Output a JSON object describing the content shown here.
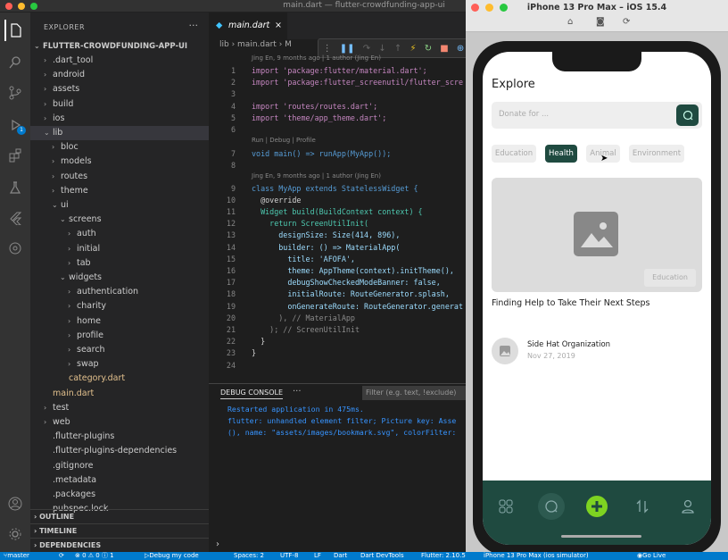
{
  "window": {
    "title": "main.dart — flutter-crowdfunding-app-ui"
  },
  "sidebar": {
    "header": "EXPLORER",
    "root": "FLUTTER-CROWDFUNDING-APP-UI",
    "tree": [
      {
        "label": ".dart_tool",
        "indent": 1,
        "chev": "›"
      },
      {
        "label": "android",
        "indent": 1,
        "chev": "›"
      },
      {
        "label": "assets",
        "indent": 1,
        "chev": "›"
      },
      {
        "label": "build",
        "indent": 1,
        "chev": "›"
      },
      {
        "label": "ios",
        "indent": 1,
        "chev": "›"
      },
      {
        "label": "lib",
        "indent": 1,
        "chev": "⌄"
      },
      {
        "label": "bloc",
        "indent": 2,
        "chev": "›"
      },
      {
        "label": "models",
        "indent": 2,
        "chev": "›"
      },
      {
        "label": "routes",
        "indent": 2,
        "chev": "›"
      },
      {
        "label": "theme",
        "indent": 2,
        "chev": "›"
      },
      {
        "label": "ui",
        "indent": 2,
        "chev": "⌄"
      },
      {
        "label": "screens",
        "indent": 3,
        "chev": "⌄"
      },
      {
        "label": "auth",
        "indent": 4,
        "chev": "›"
      },
      {
        "label": "initial",
        "indent": 4,
        "chev": "›"
      },
      {
        "label": "tab",
        "indent": 4,
        "chev": "›"
      },
      {
        "label": "widgets",
        "indent": 3,
        "chev": "⌄"
      },
      {
        "label": "authentication",
        "indent": 4,
        "chev": "›"
      },
      {
        "label": "charity",
        "indent": 4,
        "chev": "›"
      },
      {
        "label": "home",
        "indent": 4,
        "chev": "›"
      },
      {
        "label": "profile",
        "indent": 4,
        "chev": "›"
      },
      {
        "label": "search",
        "indent": 4,
        "chev": "›"
      },
      {
        "label": "swap",
        "indent": 4,
        "chev": "›"
      },
      {
        "label": "category.dart",
        "indent": 3,
        "chev": ""
      },
      {
        "label": "main.dart",
        "indent": 1,
        "chev": ""
      },
      {
        "label": "test",
        "indent": 1,
        "chev": "›"
      },
      {
        "label": "web",
        "indent": 1,
        "chev": "›"
      },
      {
        "label": ".flutter-plugins",
        "indent": 1,
        "chev": ""
      },
      {
        "label": ".flutter-plugins-dependencies",
        "indent": 1,
        "chev": ""
      },
      {
        "label": ".gitignore",
        "indent": 1,
        "chev": ""
      },
      {
        "label": ".metadata",
        "indent": 1,
        "chev": ""
      },
      {
        "label": ".packages",
        "indent": 1,
        "chev": ""
      },
      {
        "label": "pubspec.lock",
        "indent": 1,
        "chev": ""
      }
    ],
    "sections": [
      "OUTLINE",
      "TIMELINE",
      "DEPENDENCIES"
    ]
  },
  "editor": {
    "tab": "main.dart",
    "breadcrumb": "lib › main.dart › M",
    "lens_top": "Jing En, 9 months ago | 1 author (Jing En)",
    "lens_main": "Run | Debug | Profile",
    "lens_class": "Jing En, 9 months ago | 1 author (Jing En)",
    "lines": [
      {
        "n": "1",
        "text": "import 'package:flutter/material.dart';"
      },
      {
        "n": "2",
        "text": "import 'package:flutter_screenutil/flutter_scre"
      },
      {
        "n": "3",
        "text": ""
      },
      {
        "n": "4",
        "text": "import 'routes/routes.dart';"
      },
      {
        "n": "5",
        "text": "import 'theme/app_theme.dart';"
      },
      {
        "n": "6",
        "text": ""
      },
      {
        "n": "7",
        "text": "void main() => runApp(MyApp());"
      },
      {
        "n": "8",
        "text": ""
      },
      {
        "n": "9",
        "text": "class MyApp extends StatelessWidget {"
      },
      {
        "n": "10",
        "text": "  @override"
      },
      {
        "n": "11",
        "text": "  Widget build(BuildContext context) {"
      },
      {
        "n": "12",
        "text": "    return ScreenUtilInit("
      },
      {
        "n": "13",
        "text": "      designSize: Size(414, 896),"
      },
      {
        "n": "14",
        "text": "      builder: () => MaterialApp("
      },
      {
        "n": "15",
        "text": "        title: 'AFOFA',"
      },
      {
        "n": "16",
        "text": "        theme: AppTheme(context).initTheme(),"
      },
      {
        "n": "17",
        "text": "        debugShowCheckedModeBanner: false,"
      },
      {
        "n": "18",
        "text": "        initialRoute: RouteGenerator.splash,"
      },
      {
        "n": "19",
        "text": "        onGenerateRoute: RouteGenerator.generat"
      },
      {
        "n": "20",
        "text": "      ), // MaterialApp"
      },
      {
        "n": "21",
        "text": "    ); // ScreenUtilInit"
      },
      {
        "n": "22",
        "text": "  }"
      },
      {
        "n": "23",
        "text": "}"
      },
      {
        "n": "24",
        "text": ""
      }
    ]
  },
  "panel": {
    "title": "DEBUG CONSOLE",
    "filter_placeholder": "Filter (e.g. text, !exclude)",
    "lines": [
      "Restarted application in 475ms.",
      "flutter: unhandled element filter; Picture key: Asse",
      "(), name: \"assets/images/bookmark.svg\", colorFilter:"
    ],
    "prompt": "›"
  },
  "statusbar": {
    "branch": "master",
    "problems": "⊗ 0 ⚠ 0 ⓘ 1",
    "debug": "Debug my code",
    "spaces": "Spaces: 2",
    "encoding": "UTF-8",
    "eol": "LF",
    "lang": "Dart",
    "devtools": "Dart DevTools",
    "flutter": "Flutter: 2.10.5",
    "device": "iPhone 13 Pro Max (ios simulator)",
    "golive": "Go Live"
  },
  "simulator": {
    "title": "iPhone 13 Pro Max – iOS 15.4",
    "app_title": "Explore",
    "search_placeholder": "Donate for ...",
    "chips": [
      {
        "label": "Education",
        "active": false
      },
      {
        "label": "Health",
        "active": true
      },
      {
        "label": "Animal",
        "active": false
      },
      {
        "label": "Environment",
        "active": false
      }
    ],
    "card_category": "Education",
    "card_title": "Finding Help to Take Their Next Steps",
    "org_name": "Side Hat Organization",
    "org_date": "Nov 27, 2019",
    "colors": {
      "brand": "#1f4a40",
      "accent": "#7ed321"
    }
  }
}
